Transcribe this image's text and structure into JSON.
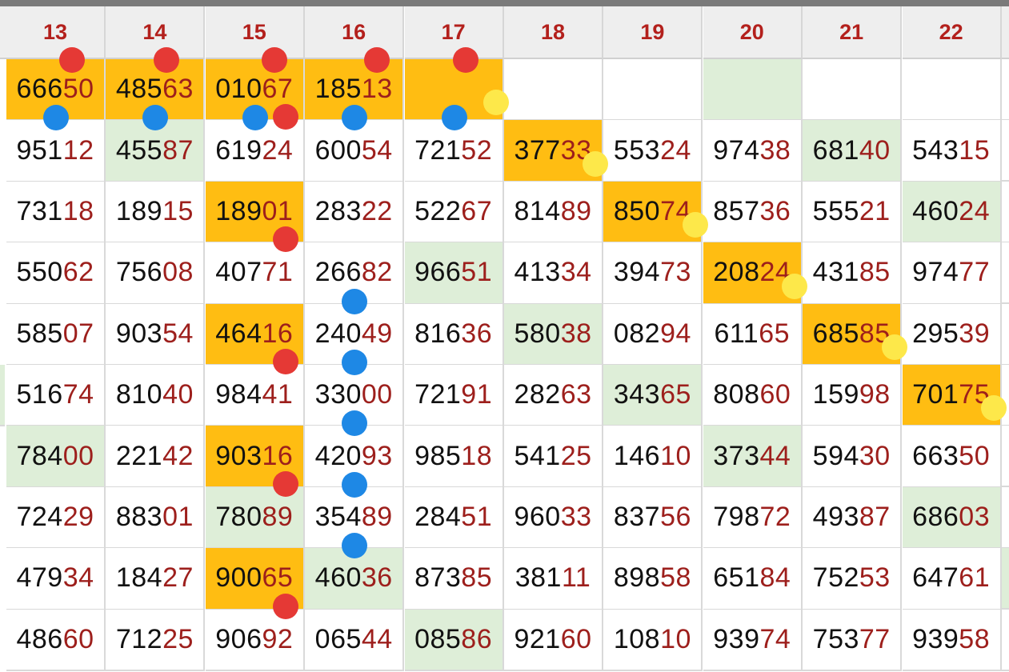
{
  "columns": [
    "13",
    "14",
    "15",
    "16",
    "17",
    "18",
    "19",
    "20",
    "21",
    "22"
  ],
  "rows": [
    {
      "cells": [
        {
          "prefix": "666",
          "suffix": "50",
          "bg": "orange"
        },
        {
          "prefix": "485",
          "suffix": "63",
          "bg": "orange"
        },
        {
          "prefix": "010",
          "suffix": "67",
          "bg": "orange"
        },
        {
          "prefix": "185",
          "suffix": "13",
          "bg": "orange"
        },
        {
          "prefix": "",
          "suffix": "",
          "bg": "orange"
        },
        {
          "prefix": "",
          "suffix": "",
          "bg": "white"
        },
        {
          "prefix": "",
          "suffix": "",
          "bg": "white"
        },
        {
          "prefix": "",
          "suffix": "",
          "bg": "green"
        },
        {
          "prefix": "",
          "suffix": "",
          "bg": "white"
        },
        {
          "prefix": "",
          "suffix": "",
          "bg": "white"
        }
      ]
    },
    {
      "cells": [
        {
          "prefix": "951",
          "suffix": "12",
          "bg": "white"
        },
        {
          "prefix": "455",
          "suffix": "87",
          "bg": "green"
        },
        {
          "prefix": "619",
          "suffix": "24",
          "bg": "white"
        },
        {
          "prefix": "600",
          "suffix": "54",
          "bg": "white"
        },
        {
          "prefix": "721",
          "suffix": "52",
          "bg": "white"
        },
        {
          "prefix": "377",
          "suffix": "33",
          "bg": "orange"
        },
        {
          "prefix": "553",
          "suffix": "24",
          "bg": "white"
        },
        {
          "prefix": "974",
          "suffix": "38",
          "bg": "white"
        },
        {
          "prefix": "681",
          "suffix": "40",
          "bg": "green"
        },
        {
          "prefix": "543",
          "suffix": "15",
          "bg": "white"
        }
      ]
    },
    {
      "cells": [
        {
          "prefix": "731",
          "suffix": "18",
          "bg": "white"
        },
        {
          "prefix": "189",
          "suffix": "15",
          "bg": "white"
        },
        {
          "prefix": "189",
          "suffix": "01",
          "bg": "orange"
        },
        {
          "prefix": "283",
          "suffix": "22",
          "bg": "white"
        },
        {
          "prefix": "522",
          "suffix": "67",
          "bg": "white"
        },
        {
          "prefix": "814",
          "suffix": "89",
          "bg": "white"
        },
        {
          "prefix": "850",
          "suffix": "74",
          "bg": "orange"
        },
        {
          "prefix": "857",
          "suffix": "36",
          "bg": "white"
        },
        {
          "prefix": "555",
          "suffix": "21",
          "bg": "white"
        },
        {
          "prefix": "460",
          "suffix": "24",
          "bg": "green"
        }
      ]
    },
    {
      "cells": [
        {
          "prefix": "550",
          "suffix": "62",
          "bg": "white"
        },
        {
          "prefix": "756",
          "suffix": "08",
          "bg": "white"
        },
        {
          "prefix": "407",
          "suffix": "71",
          "bg": "white"
        },
        {
          "prefix": "266",
          "suffix": "82",
          "bg": "white"
        },
        {
          "prefix": "966",
          "suffix": "51",
          "bg": "green"
        },
        {
          "prefix": "413",
          "suffix": "34",
          "bg": "white"
        },
        {
          "prefix": "394",
          "suffix": "73",
          "bg": "white"
        },
        {
          "prefix": "208",
          "suffix": "24",
          "bg": "orange"
        },
        {
          "prefix": "431",
          "suffix": "85",
          "bg": "white"
        },
        {
          "prefix": "974",
          "suffix": "77",
          "bg": "white"
        }
      ]
    },
    {
      "cells": [
        {
          "prefix": "585",
          "suffix": "07",
          "bg": "white"
        },
        {
          "prefix": "903",
          "suffix": "54",
          "bg": "white"
        },
        {
          "prefix": "464",
          "suffix": "16",
          "bg": "orange"
        },
        {
          "prefix": "240",
          "suffix": "49",
          "bg": "white"
        },
        {
          "prefix": "816",
          "suffix": "36",
          "bg": "white"
        },
        {
          "prefix": "580",
          "suffix": "38",
          "bg": "green"
        },
        {
          "prefix": "082",
          "suffix": "94",
          "bg": "white"
        },
        {
          "prefix": "611",
          "suffix": "65",
          "bg": "white"
        },
        {
          "prefix": "685",
          "suffix": "85",
          "bg": "orange"
        },
        {
          "prefix": "295",
          "suffix": "39",
          "bg": "white"
        }
      ]
    },
    {
      "cells": [
        {
          "prefix": "516",
          "suffix": "74",
          "bg": "white"
        },
        {
          "prefix": "810",
          "suffix": "40",
          "bg": "white"
        },
        {
          "prefix": "984",
          "suffix": "41",
          "bg": "white"
        },
        {
          "prefix": "330",
          "suffix": "00",
          "bg": "white"
        },
        {
          "prefix": "721",
          "suffix": "91",
          "bg": "white"
        },
        {
          "prefix": "282",
          "suffix": "63",
          "bg": "white"
        },
        {
          "prefix": "343",
          "suffix": "65",
          "bg": "green"
        },
        {
          "prefix": "808",
          "suffix": "60",
          "bg": "white"
        },
        {
          "prefix": "159",
          "suffix": "98",
          "bg": "white"
        },
        {
          "prefix": "701",
          "suffix": "75",
          "bg": "orange"
        }
      ]
    },
    {
      "cells": [
        {
          "prefix": "784",
          "suffix": "00",
          "bg": "green"
        },
        {
          "prefix": "221",
          "suffix": "42",
          "bg": "white"
        },
        {
          "prefix": "903",
          "suffix": "16",
          "bg": "orange"
        },
        {
          "prefix": "420",
          "suffix": "93",
          "bg": "white"
        },
        {
          "prefix": "985",
          "suffix": "18",
          "bg": "white"
        },
        {
          "prefix": "541",
          "suffix": "25",
          "bg": "white"
        },
        {
          "prefix": "146",
          "suffix": "10",
          "bg": "white"
        },
        {
          "prefix": "373",
          "suffix": "44",
          "bg": "green"
        },
        {
          "prefix": "594",
          "suffix": "30",
          "bg": "white"
        },
        {
          "prefix": "663",
          "suffix": "50",
          "bg": "white"
        }
      ]
    },
    {
      "cells": [
        {
          "prefix": "724",
          "suffix": "29",
          "bg": "white"
        },
        {
          "prefix": "883",
          "suffix": "01",
          "bg": "white"
        },
        {
          "prefix": "780",
          "suffix": "89",
          "bg": "green"
        },
        {
          "prefix": "354",
          "suffix": "89",
          "bg": "white"
        },
        {
          "prefix": "284",
          "suffix": "51",
          "bg": "white"
        },
        {
          "prefix": "960",
          "suffix": "33",
          "bg": "white"
        },
        {
          "prefix": "837",
          "suffix": "56",
          "bg": "white"
        },
        {
          "prefix": "798",
          "suffix": "72",
          "bg": "white"
        },
        {
          "prefix": "493",
          "suffix": "87",
          "bg": "white"
        },
        {
          "prefix": "686",
          "suffix": "03",
          "bg": "green"
        }
      ]
    },
    {
      "cells": [
        {
          "prefix": "479",
          "suffix": "34",
          "bg": "white"
        },
        {
          "prefix": "184",
          "suffix": "27",
          "bg": "white"
        },
        {
          "prefix": "900",
          "suffix": "65",
          "bg": "orange"
        },
        {
          "prefix": "460",
          "suffix": "36",
          "bg": "green"
        },
        {
          "prefix": "873",
          "suffix": "85",
          "bg": "white"
        },
        {
          "prefix": "381",
          "suffix": "11",
          "bg": "white"
        },
        {
          "prefix": "898",
          "suffix": "58",
          "bg": "white"
        },
        {
          "prefix": "651",
          "suffix": "84",
          "bg": "white"
        },
        {
          "prefix": "752",
          "suffix": "53",
          "bg": "white"
        },
        {
          "prefix": "647",
          "suffix": "61",
          "bg": "white"
        }
      ]
    },
    {
      "cells": [
        {
          "prefix": "486",
          "suffix": "60",
          "bg": "white"
        },
        {
          "prefix": "712",
          "suffix": "25",
          "bg": "white"
        },
        {
          "prefix": "906",
          "suffix": "92",
          "bg": "white"
        },
        {
          "prefix": "065",
          "suffix": "44",
          "bg": "white"
        },
        {
          "prefix": "085",
          "suffix": "86",
          "bg": "green"
        },
        {
          "prefix": "921",
          "suffix": "60",
          "bg": "white"
        },
        {
          "prefix": "108",
          "suffix": "10",
          "bg": "white"
        },
        {
          "prefix": "939",
          "suffix": "74",
          "bg": "white"
        },
        {
          "prefix": "753",
          "suffix": "77",
          "bg": "white"
        },
        {
          "prefix": "939",
          "suffix": "58",
          "bg": "white"
        }
      ]
    }
  ],
  "markers": [
    {
      "kind": "red",
      "row": 0,
      "col": 0,
      "at": "top"
    },
    {
      "kind": "red",
      "row": 0,
      "col": 1,
      "at": "top"
    },
    {
      "kind": "red",
      "row": 0,
      "col": 2,
      "at": "top"
    },
    {
      "kind": "red",
      "row": 0,
      "col": 3,
      "at": "top"
    },
    {
      "kind": "red",
      "row": 0,
      "col": 4,
      "at": "top"
    },
    {
      "kind": "blue",
      "row": 0,
      "col": 0,
      "at": "bottom"
    },
    {
      "kind": "blue",
      "row": 0,
      "col": 1,
      "at": "bottom"
    },
    {
      "kind": "blue",
      "row": 0,
      "col": 2,
      "at": "bottom"
    },
    {
      "kind": "red",
      "row": 0,
      "col": 2,
      "at": "bottom-right"
    },
    {
      "kind": "blue",
      "row": 0,
      "col": 3,
      "at": "bottom"
    },
    {
      "kind": "blue",
      "row": 0,
      "col": 4,
      "at": "bottom"
    },
    {
      "kind": "yellow",
      "row": 0,
      "col": 4,
      "at": "corner"
    },
    {
      "kind": "yellow",
      "row": 1,
      "col": 5,
      "at": "corner"
    },
    {
      "kind": "red",
      "row": 2,
      "col": 2,
      "at": "bottom-right"
    },
    {
      "kind": "yellow",
      "row": 2,
      "col": 6,
      "at": "corner"
    },
    {
      "kind": "blue",
      "row": 3,
      "col": 3,
      "at": "bottom"
    },
    {
      "kind": "yellow",
      "row": 3,
      "col": 7,
      "at": "corner"
    },
    {
      "kind": "red",
      "row": 4,
      "col": 2,
      "at": "bottom-right"
    },
    {
      "kind": "blue",
      "row": 4,
      "col": 3,
      "at": "bottom"
    },
    {
      "kind": "yellow",
      "row": 4,
      "col": 8,
      "at": "corner"
    },
    {
      "kind": "blue",
      "row": 5,
      "col": 3,
      "at": "bottom"
    },
    {
      "kind": "yellow",
      "row": 5,
      "col": 9,
      "at": "corner"
    },
    {
      "kind": "red",
      "row": 6,
      "col": 2,
      "at": "bottom-right"
    },
    {
      "kind": "blue",
      "row": 6,
      "col": 3,
      "at": "bottom"
    },
    {
      "kind": "blue",
      "row": 7,
      "col": 3,
      "at": "bottom"
    },
    {
      "kind": "red",
      "row": 8,
      "col": 2,
      "at": "bottom-right"
    }
  ],
  "colors": {
    "orange": "#ffbd12",
    "green": "#deeed8",
    "red_digits": "#9d1f1c",
    "header_text": "#b3201c",
    "red_dot": "#e53935",
    "blue_dot": "#1e88e5",
    "yellow_dot": "#fde84a"
  }
}
